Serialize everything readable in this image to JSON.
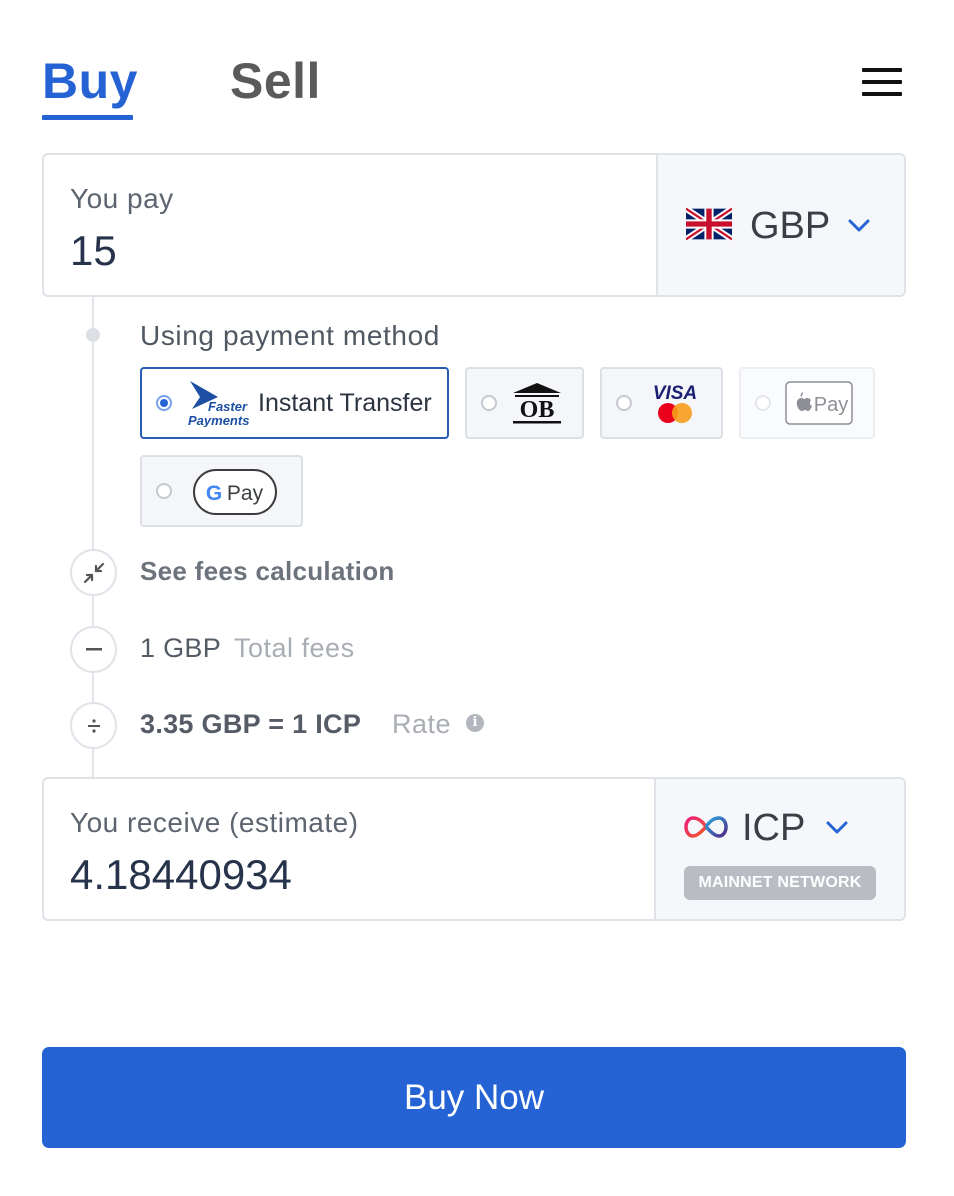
{
  "tabs": {
    "buy": "Buy",
    "sell": "Sell",
    "active": "buy"
  },
  "pay": {
    "label": "You pay",
    "value": "15",
    "currency": "GBP",
    "currency_icon": "uk-flag-icon"
  },
  "payment_methods": {
    "label": "Using payment method",
    "options": [
      {
        "id": "faster-payments",
        "label": "Instant Transfer",
        "logo_line1": "Faster",
        "logo_line2": "Payments",
        "selected": true
      },
      {
        "id": "open-banking",
        "logo_text": "OB",
        "selected": false
      },
      {
        "id": "visa-mastercard",
        "logo_text": "VISA",
        "selected": false
      },
      {
        "id": "apple-pay",
        "logo_text": "Pay",
        "selected": false,
        "disabled": true
      },
      {
        "id": "google-pay",
        "logo_text": "Pay",
        "logo_letter": "G",
        "selected": false
      }
    ]
  },
  "fees": {
    "toggle_label": "See fees calculation",
    "total_value": "1 GBP",
    "total_label": "Total fees",
    "rate_value": "3.35 GBP = 1 ICP",
    "rate_label": "Rate",
    "info_glyph": "i"
  },
  "receive": {
    "label": "You receive (estimate)",
    "value": "4.18440934",
    "currency": "ICP",
    "currency_icon": "icp-infinity-icon",
    "network": "MAINNET NETWORK"
  },
  "cta": {
    "label": "Buy Now"
  },
  "colors": {
    "accent": "#2563d4",
    "selected_border": "#2a5cb4",
    "badge": "#b9bcc3"
  }
}
